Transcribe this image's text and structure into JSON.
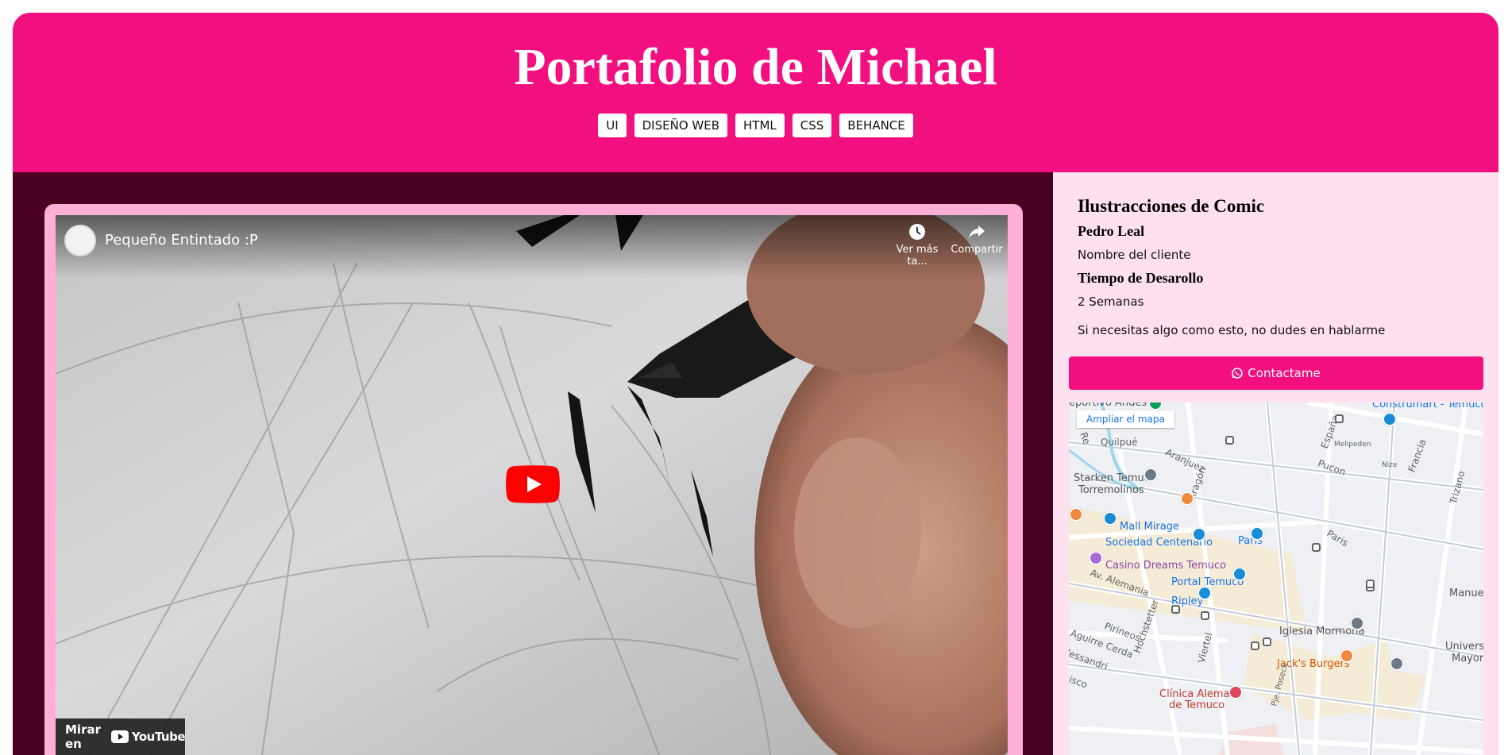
{
  "header": {
    "title": "Portafolio de Michael",
    "tags": [
      "UI",
      "DISEÑO WEB",
      "HTML",
      "CSS",
      "BEHANCE"
    ]
  },
  "video": {
    "title": "Pequeño Entintado :P",
    "watch_later": "Ver más ta...",
    "share": "Compartir",
    "watch_on": "Mirar en",
    "youtube": "YouTube"
  },
  "project": {
    "title": "Ilustracciones de Comic",
    "client_name": "Pedro Leal",
    "client_label": "Nombre del cliente",
    "time_heading": "Tiempo de Desarollo",
    "time_value": "2 Semanas",
    "cta_text": "Si necesitas algo como esto, no dudes en hablarme",
    "contact_button": "Contactame"
  },
  "map": {
    "enlarge": "Ampliar el mapa",
    "labels": {
      "deportivo": "eportivo Andes",
      "construmart": "Construmart - Temuco",
      "quilpue": "Quilpué",
      "aranjuez": "Aranjuez",
      "espana": "España",
      "melipeden": "Melipeden",
      "pucon": "Pucon",
      "nize": "Nize",
      "francia": "Francia",
      "trizano": "Trizano",
      "starken": "Starken Temuco",
      "torremolinos": "Torremolinos",
      "aragon": "Aragón",
      "mall": "Mall Mirage",
      "sociedad": "Sociedad Centenario",
      "paris_pin": "Paris",
      "paris_street": "Paris",
      "casino": "Casino Dreams Temuco",
      "portal": "Portal Temuco",
      "alemania": "Av. Alemania",
      "ripley": "Ripley",
      "manuel": "Manuel",
      "hochstetter": "Hochstetter",
      "pirineos": "Pirineos",
      "iglesia": "Iglesia Mormona",
      "aguirre": "Aguirre Cerda",
      "lessandri": "lessandri",
      "viertel": "Viertel",
      "univ1": "Universic",
      "univ2": "Mayor",
      "jacks": "Jack's Burgers",
      "isco": "isco",
      "clinica1": "Clínica Alemana",
      "clinica2": "de Temuco",
      "poseck": "Pje. Poseck",
      "r_street": "Re"
    }
  },
  "colors": {
    "header_bg": "#f20f80",
    "main_bg": "#4a0021",
    "frame": "#ffaed6",
    "sidebar_bg": "#ffe0ef",
    "button": "#f20f80"
  }
}
